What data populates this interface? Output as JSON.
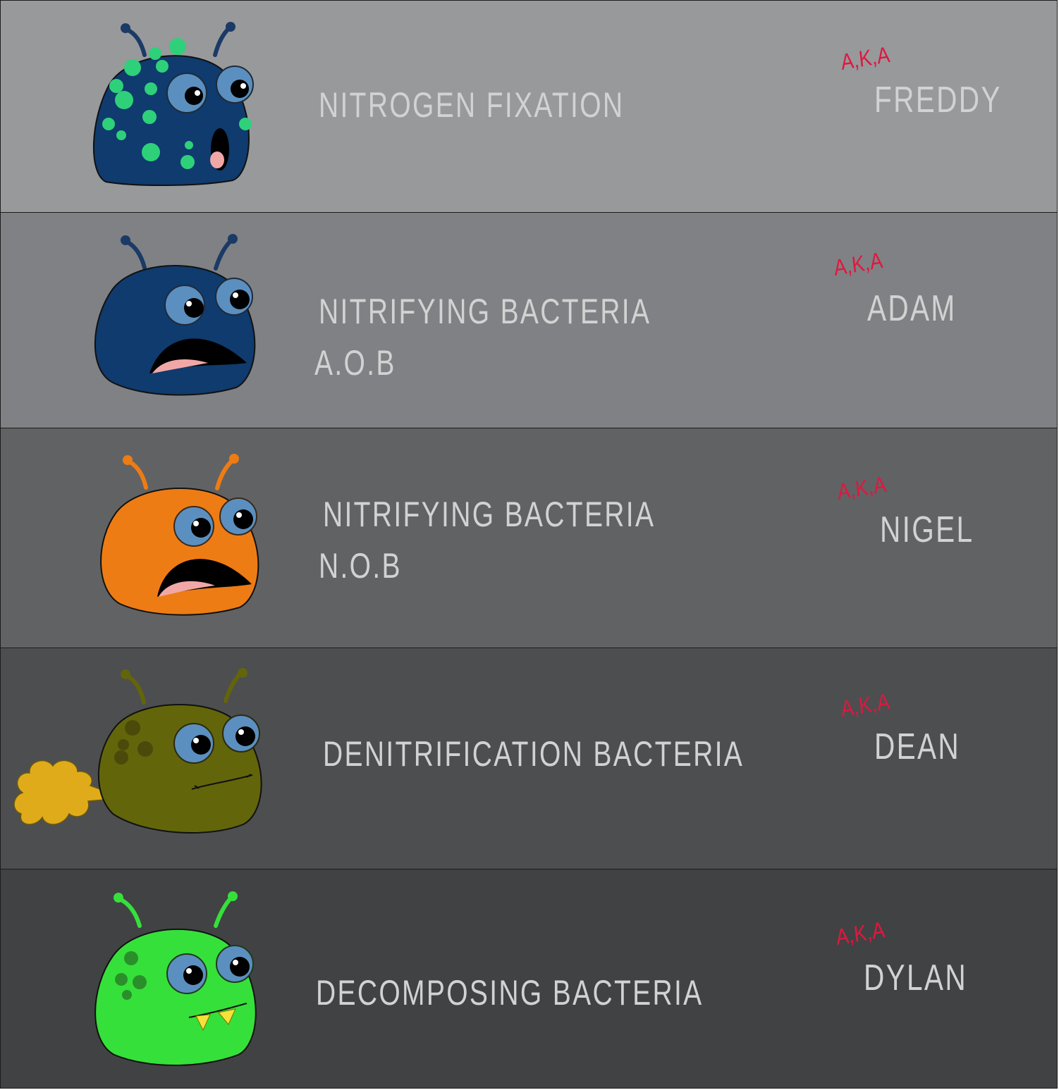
{
  "rows": [
    {
      "title_line1": "NITROGEN FIXATION",
      "title_line2": "",
      "aka": "A,K,A",
      "nickname": "FREDDY",
      "band_color": "#98999b",
      "body_color": "#0f3b6e"
    },
    {
      "title_line1": "NITRIFYING BACTERIA",
      "title_line2": "A.O.B",
      "aka": "A,K,A",
      "nickname": "ADAM",
      "band_color": "#808184",
      "body_color": "#0f3b6e"
    },
    {
      "title_line1": "NITRIFYING BACTERIA",
      "title_line2": "N.O.B",
      "aka": "A,K,A",
      "nickname": "NIGEL",
      "band_color": "#616264",
      "body_color": "#ee7c14"
    },
    {
      "title_line1": "DENITRIFICATION BACTERIA",
      "title_line2": "",
      "aka": "A,K,A",
      "nickname": "DEAN",
      "band_color": "#4d4e50",
      "body_color": "#62650a"
    },
    {
      "title_line1": "DECOMPOSING BACTERIA",
      "title_line2": "",
      "aka": "A,K,A",
      "nickname": "DYLAN",
      "band_color": "#414244",
      "body_color": "#36e03a"
    }
  ]
}
